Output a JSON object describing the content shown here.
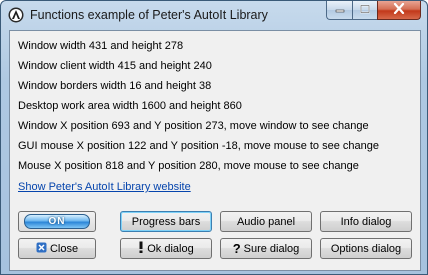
{
  "window": {
    "title": "Functions example of Peter's AutoIt Library",
    "icon": "autoit-app-icon",
    "caption_buttons": [
      "minimize-icon",
      "maximize-icon",
      "close-icon"
    ]
  },
  "info": {
    "line1": "Window width 431 and height 278",
    "line2": "Window client width 415 and height 240",
    "line3": "Window borders width 16 and height 38",
    "line4": "Desktop work area width 1600 and height 860",
    "line5": "Window X position 693 and Y position 273, move window to see change",
    "line6": "GUI mouse X position 122 and Y position -18, move mouse to see change",
    "line7": "Mouse X position 818 and Y position 280, move mouse to see change"
  },
  "link": {
    "label": "Show Peter's AutoIt Library website"
  },
  "buttons": {
    "on_label": "ON",
    "progress_bars": "Progress bars",
    "audio_panel": "Audio panel",
    "info_dialog": "Info dialog",
    "close": "Close",
    "ok_dialog": "Ok dialog",
    "sure_dialog": "Sure dialog",
    "options_dialog": "Options dialog",
    "close_icon": "x-icon",
    "ok_icon": "exclamation-icon",
    "sure_icon": "question-icon"
  },
  "colors": {
    "link": "#0645ad",
    "on_accent": "#2c86d8",
    "close_caption": "#c2391a"
  }
}
